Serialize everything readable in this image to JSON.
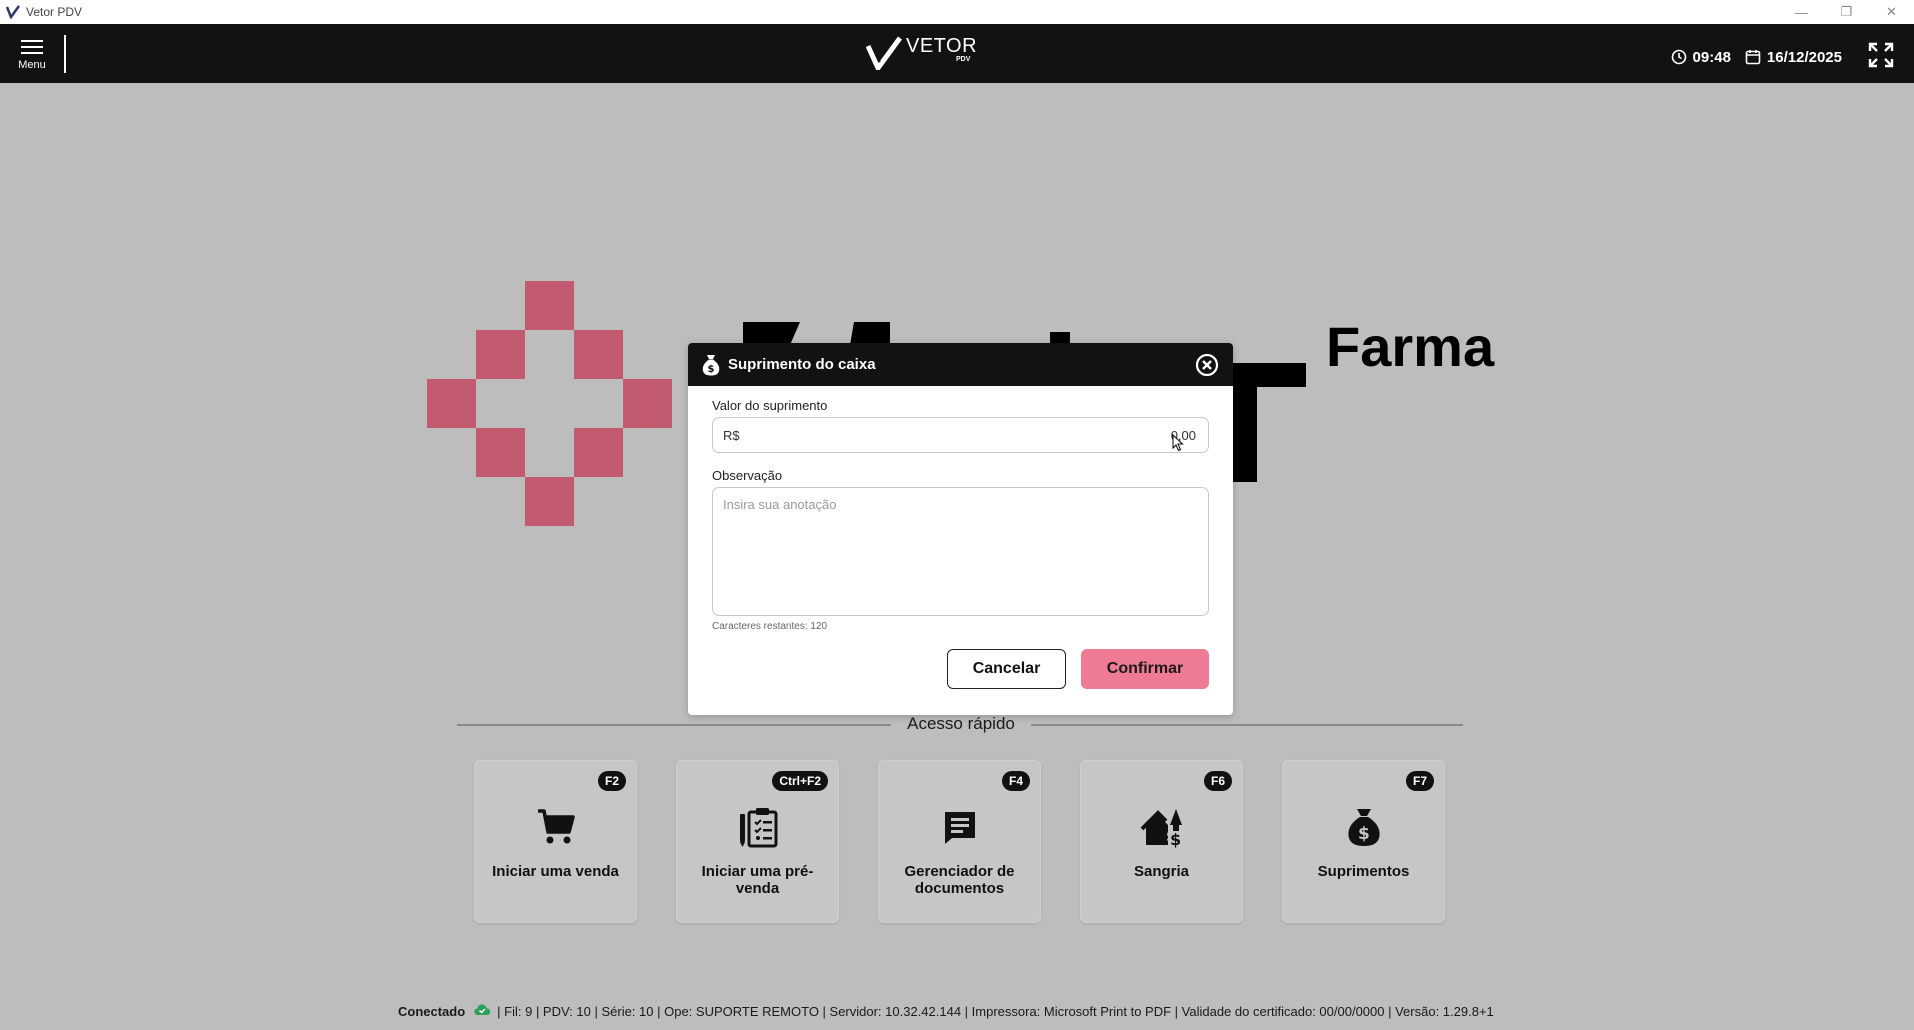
{
  "window": {
    "title": "Vetor PDV",
    "controls": [
      "—",
      "❐",
      "✕"
    ]
  },
  "header": {
    "menu_label": "Menu",
    "brand_name": "VETOR",
    "brand_sub": "PDV",
    "time": "09:48",
    "date": "16/12/2025"
  },
  "background": {
    "brand_word": "Farma",
    "accent_color": "#c25a70"
  },
  "modal": {
    "title": "Suprimento do caixa",
    "value_label": "Valor do suprimento",
    "currency": "R$",
    "value": "0,00",
    "obs_label": "Observação",
    "obs_placeholder": "Insira sua anotação",
    "chars_left": "Caracteres restantes: 120",
    "cancel_label": "Cancelar",
    "confirm_label": "Confirmar",
    "confirm_color": "#ee7a93"
  },
  "quick_access": {
    "title": "Acesso rápido",
    "cards": [
      {
        "key": "F2",
        "label": "Iniciar uma venda",
        "icon": "cart-icon"
      },
      {
        "key": "Ctrl+F2",
        "label": "Iniciar uma pré-venda",
        "icon": "pre-sale-clipboard-icon"
      },
      {
        "key": "F4",
        "label": "Gerenciador de documentos",
        "icon": "document-manager-icon"
      },
      {
        "key": "F6",
        "label": "Sangria",
        "icon": "cash-out-house-icon"
      },
      {
        "key": "F7",
        "label": "Suprimentos",
        "icon": "money-bag-icon"
      }
    ]
  },
  "status_bar": {
    "connection": "Conectado",
    "details": "| Fil: 9 | PDV: 10 | Série: 10 | Ope: SUPORTE REMOTO | Servidor: 10.32.42.144 | Impressora: Microsoft Print to PDF | Validade do certificado: 00/00/0000 | Versão: 1.29.8+1"
  }
}
